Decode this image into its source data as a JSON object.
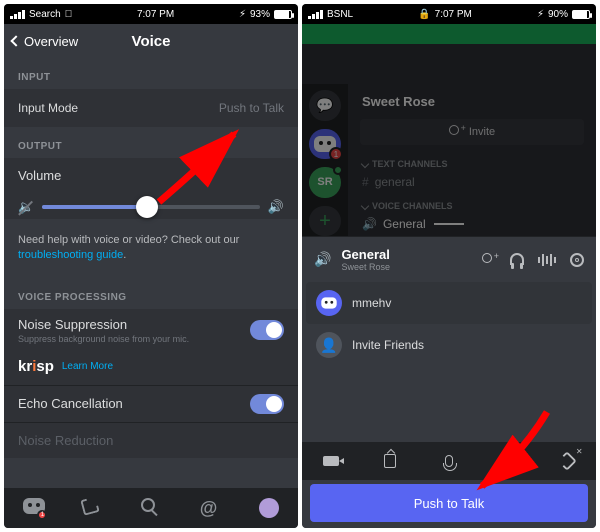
{
  "left": {
    "status": {
      "carrier": "Search",
      "time": "7:07 PM",
      "battery": "93%"
    },
    "header": {
      "back": "Overview",
      "title": "Voice"
    },
    "section_input": "INPUT",
    "input_mode": {
      "label": "Input Mode",
      "value": "Push to Talk"
    },
    "section_output": "OUTPUT",
    "volume_label": "Volume",
    "help_text": "Need help with voice or video? Check out our ",
    "help_link": "troubleshooting guide",
    "help_dot": ".",
    "section_vp": "VOICE PROCESSING",
    "noise": {
      "title": "Noise Suppression",
      "sub": "Suppress background noise from your mic."
    },
    "krisp": {
      "brand_left": "kr",
      "brand_mid": "i",
      "brand_right": "sp",
      "learn": "Learn More"
    },
    "echo": {
      "title": "Echo Cancellation"
    },
    "noise_red": {
      "title": "Noise Reduction"
    },
    "bottom_badge": "1"
  },
  "right": {
    "status": {
      "carrier": "BSNL",
      "time": "7:07 PM",
      "battery": "90%"
    },
    "server_name": "Sweet Rose",
    "invite_btn": "Invite",
    "sr_initials": "SR",
    "badge1": "1",
    "text_channels": "TEXT CHANNELS",
    "chan_general": "general",
    "voice_channels": "VOICE CHANNELS",
    "chan_general_v": "General",
    "voice": {
      "channel": "General",
      "server": "Sweet Rose"
    },
    "person1": "mmehv",
    "invite_friends": "Invite Friends",
    "ptt": "Push to Talk"
  }
}
